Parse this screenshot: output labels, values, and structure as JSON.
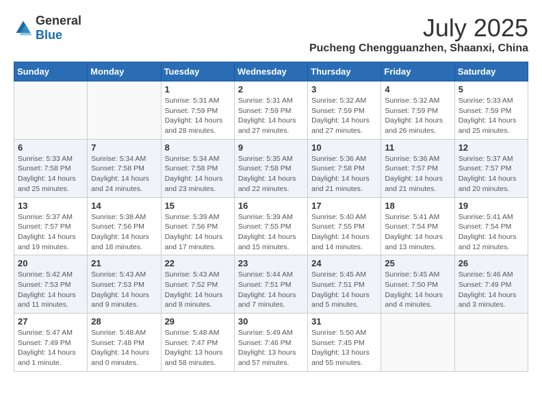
{
  "header": {
    "logo": {
      "general": "General",
      "blue": "Blue"
    },
    "month_year": "July 2025",
    "location": "Pucheng Chengguanzhen, Shaanxi, China"
  },
  "weekdays": [
    "Sunday",
    "Monday",
    "Tuesday",
    "Wednesday",
    "Thursday",
    "Friday",
    "Saturday"
  ],
  "weeks": [
    [
      {
        "day": "",
        "info": ""
      },
      {
        "day": "",
        "info": ""
      },
      {
        "day": "1",
        "info": "Sunrise: 5:31 AM\nSunset: 7:59 PM\nDaylight: 14 hours and 28 minutes."
      },
      {
        "day": "2",
        "info": "Sunrise: 5:31 AM\nSunset: 7:59 PM\nDaylight: 14 hours and 27 minutes."
      },
      {
        "day": "3",
        "info": "Sunrise: 5:32 AM\nSunset: 7:59 PM\nDaylight: 14 hours and 27 minutes."
      },
      {
        "day": "4",
        "info": "Sunrise: 5:32 AM\nSunset: 7:59 PM\nDaylight: 14 hours and 26 minutes."
      },
      {
        "day": "5",
        "info": "Sunrise: 5:33 AM\nSunset: 7:59 PM\nDaylight: 14 hours and 25 minutes."
      }
    ],
    [
      {
        "day": "6",
        "info": "Sunrise: 5:33 AM\nSunset: 7:58 PM\nDaylight: 14 hours and 25 minutes."
      },
      {
        "day": "7",
        "info": "Sunrise: 5:34 AM\nSunset: 7:58 PM\nDaylight: 14 hours and 24 minutes."
      },
      {
        "day": "8",
        "info": "Sunrise: 5:34 AM\nSunset: 7:58 PM\nDaylight: 14 hours and 23 minutes."
      },
      {
        "day": "9",
        "info": "Sunrise: 5:35 AM\nSunset: 7:58 PM\nDaylight: 14 hours and 22 minutes."
      },
      {
        "day": "10",
        "info": "Sunrise: 5:36 AM\nSunset: 7:58 PM\nDaylight: 14 hours and 21 minutes."
      },
      {
        "day": "11",
        "info": "Sunrise: 5:36 AM\nSunset: 7:57 PM\nDaylight: 14 hours and 21 minutes."
      },
      {
        "day": "12",
        "info": "Sunrise: 5:37 AM\nSunset: 7:57 PM\nDaylight: 14 hours and 20 minutes."
      }
    ],
    [
      {
        "day": "13",
        "info": "Sunrise: 5:37 AM\nSunset: 7:57 PM\nDaylight: 14 hours and 19 minutes."
      },
      {
        "day": "14",
        "info": "Sunrise: 5:38 AM\nSunset: 7:56 PM\nDaylight: 14 hours and 18 minutes."
      },
      {
        "day": "15",
        "info": "Sunrise: 5:39 AM\nSunset: 7:56 PM\nDaylight: 14 hours and 17 minutes."
      },
      {
        "day": "16",
        "info": "Sunrise: 5:39 AM\nSunset: 7:55 PM\nDaylight: 14 hours and 15 minutes."
      },
      {
        "day": "17",
        "info": "Sunrise: 5:40 AM\nSunset: 7:55 PM\nDaylight: 14 hours and 14 minutes."
      },
      {
        "day": "18",
        "info": "Sunrise: 5:41 AM\nSunset: 7:54 PM\nDaylight: 14 hours and 13 minutes."
      },
      {
        "day": "19",
        "info": "Sunrise: 5:41 AM\nSunset: 7:54 PM\nDaylight: 14 hours and 12 minutes."
      }
    ],
    [
      {
        "day": "20",
        "info": "Sunrise: 5:42 AM\nSunset: 7:53 PM\nDaylight: 14 hours and 11 minutes."
      },
      {
        "day": "21",
        "info": "Sunrise: 5:43 AM\nSunset: 7:53 PM\nDaylight: 14 hours and 9 minutes."
      },
      {
        "day": "22",
        "info": "Sunrise: 5:43 AM\nSunset: 7:52 PM\nDaylight: 14 hours and 8 minutes."
      },
      {
        "day": "23",
        "info": "Sunrise: 5:44 AM\nSunset: 7:51 PM\nDaylight: 14 hours and 7 minutes."
      },
      {
        "day": "24",
        "info": "Sunrise: 5:45 AM\nSunset: 7:51 PM\nDaylight: 14 hours and 5 minutes."
      },
      {
        "day": "25",
        "info": "Sunrise: 5:45 AM\nSunset: 7:50 PM\nDaylight: 14 hours and 4 minutes."
      },
      {
        "day": "26",
        "info": "Sunrise: 5:46 AM\nSunset: 7:49 PM\nDaylight: 14 hours and 3 minutes."
      }
    ],
    [
      {
        "day": "27",
        "info": "Sunrise: 5:47 AM\nSunset: 7:49 PM\nDaylight: 14 hours and 1 minute."
      },
      {
        "day": "28",
        "info": "Sunrise: 5:48 AM\nSunset: 7:48 PM\nDaylight: 14 hours and 0 minutes."
      },
      {
        "day": "29",
        "info": "Sunrise: 5:48 AM\nSunset: 7:47 PM\nDaylight: 13 hours and 58 minutes."
      },
      {
        "day": "30",
        "info": "Sunrise: 5:49 AM\nSunset: 7:46 PM\nDaylight: 13 hours and 57 minutes."
      },
      {
        "day": "31",
        "info": "Sunrise: 5:50 AM\nSunset: 7:45 PM\nDaylight: 13 hours and 55 minutes."
      },
      {
        "day": "",
        "info": ""
      },
      {
        "day": "",
        "info": ""
      }
    ]
  ]
}
